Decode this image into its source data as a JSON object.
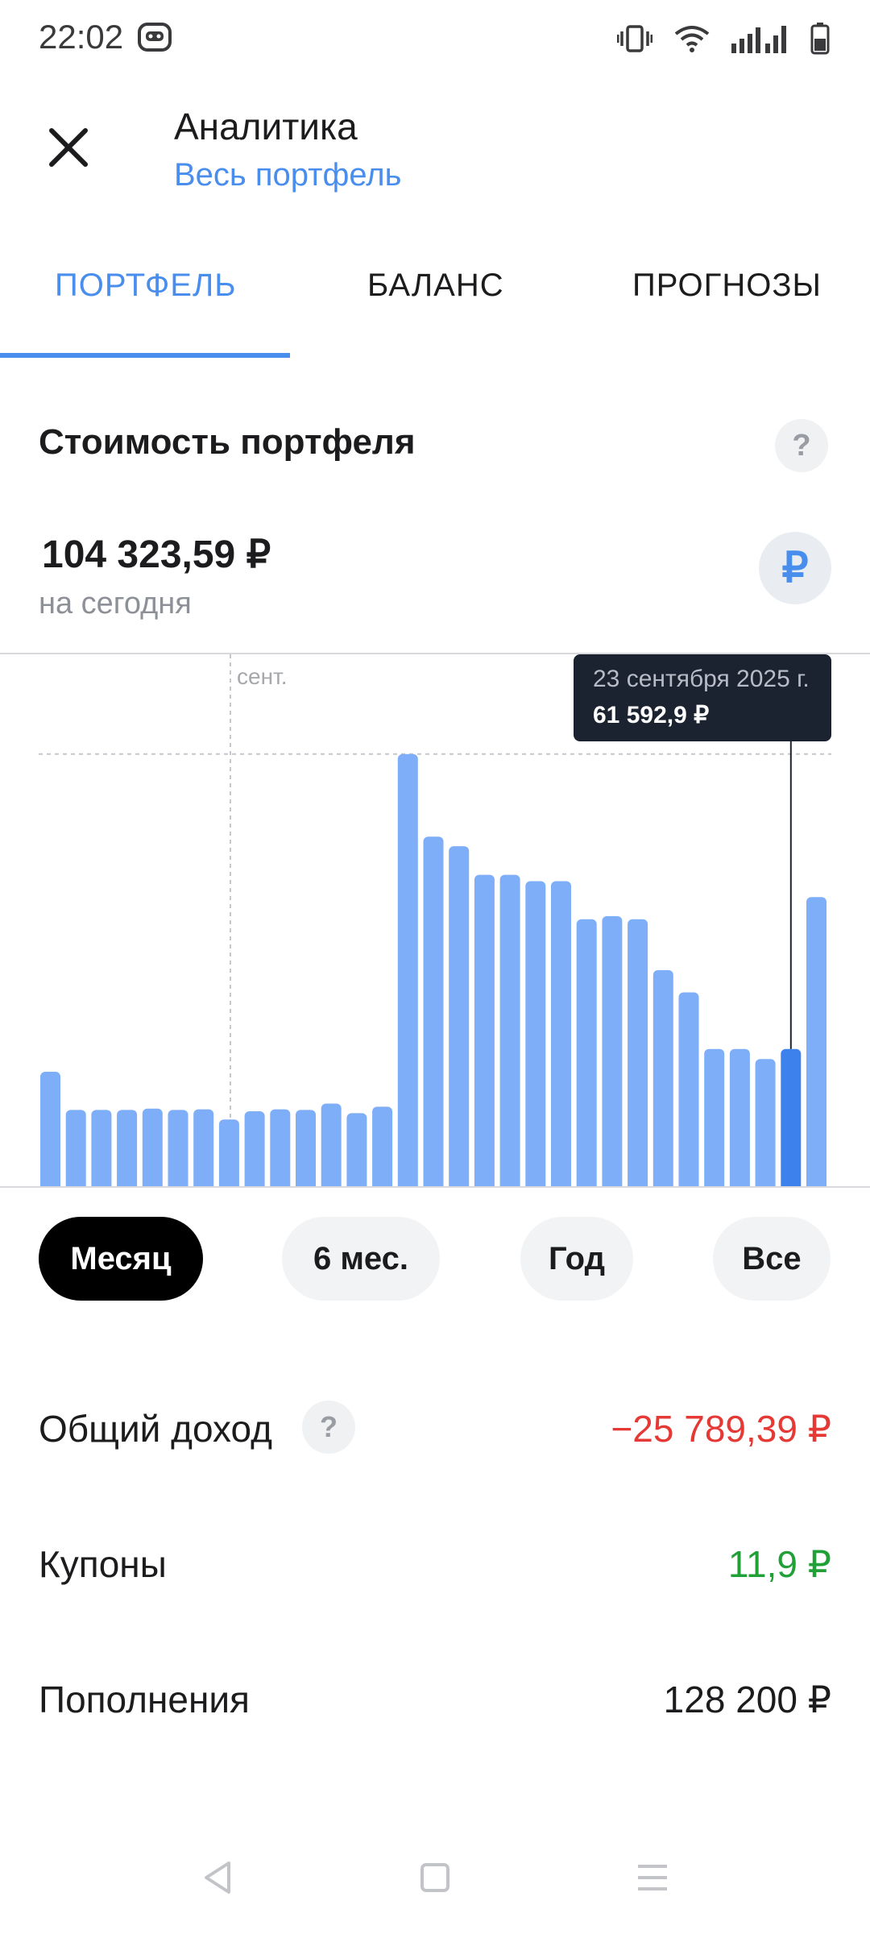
{
  "status_bar": {
    "time": "22:02"
  },
  "header": {
    "title": "Аналитика",
    "subtitle": "Весь портфель"
  },
  "tabs": [
    {
      "label": "ПОРТФЕЛЬ",
      "active": true
    },
    {
      "label": "БАЛАНС",
      "active": false
    },
    {
      "label": "ПРОГНОЗЫ",
      "active": false
    }
  ],
  "portfolio": {
    "section_title": "Стоимость портфеля",
    "value": "104 323,59  ₽",
    "value_caption": "на сегодня",
    "currency_symbol": "₽",
    "help_symbol": "?"
  },
  "chart_data": {
    "type": "bar",
    "month_label": "сент.",
    "values": [
      58000,
      52000,
      52000,
      52000,
      52200,
      52000,
      52100,
      50500,
      51800,
      52100,
      52000,
      53000,
      51500,
      52500,
      108000,
      95000,
      93500,
      89000,
      89000,
      88000,
      88000,
      82000,
      82500,
      82000,
      74000,
      70500,
      61592.9,
      61592.9,
      60000,
      61592.9,
      85500
    ],
    "selected_index": 29,
    "reference_value": 108000,
    "ylim": [
      40000,
      110000
    ],
    "colors": {
      "bar": "#7daef7",
      "bar_selected": "#3d82ec"
    },
    "tooltip": {
      "date": "23 сентября 2025 г.",
      "value": "61 592,9 ₽"
    }
  },
  "periods": [
    {
      "label": "Месяц",
      "active": true
    },
    {
      "label": "6 мес.",
      "active": false
    },
    {
      "label": "Год",
      "active": false
    },
    {
      "label": "Все",
      "active": false
    }
  ],
  "stats": {
    "total_income": {
      "label": "Общий доход",
      "value": "−25 789,39 ₽",
      "color": "#e53935"
    },
    "coupons": {
      "label": "Купоны",
      "value": "11,9 ₽",
      "color": "#21a038"
    },
    "deposits": {
      "label": "Пополнения",
      "value": "128 200 ₽",
      "color": "#1c1c1e"
    }
  }
}
